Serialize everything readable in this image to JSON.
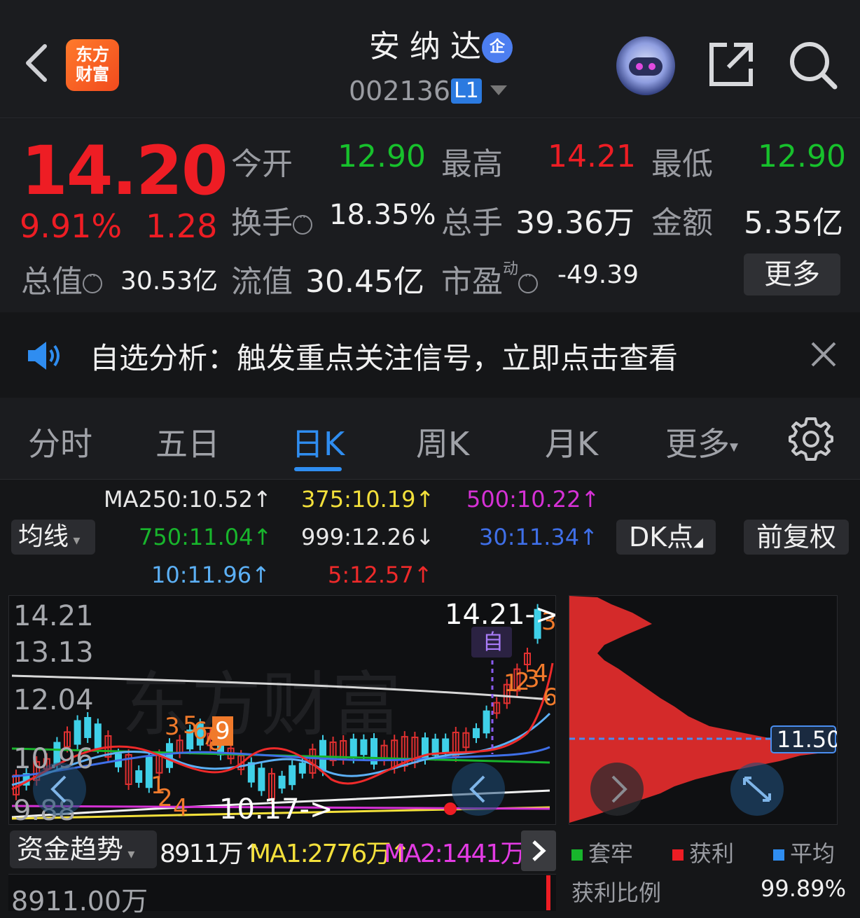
{
  "header": {
    "app_logo_text": [
      "东方",
      "财富"
    ],
    "stock_name": "安纳达",
    "company_badge": "企",
    "stock_code": "002136",
    "level_badge": "L1"
  },
  "quote": {
    "price": "14.20",
    "change_pct": "9.91%",
    "change": "1.28",
    "open_label": "今开",
    "open": "12.90",
    "high_label": "最高",
    "high": "14.21",
    "low_label": "最低",
    "low": "12.90",
    "turnover_label": "换手",
    "turnover": "18.35%",
    "volume_label": "总手",
    "volume": "39.36万",
    "amount_label": "金额",
    "amount": "5.35亿",
    "mktcap_label": "总值",
    "mktcap": "30.53亿",
    "float_label": "流值",
    "float_cap": "30.45亿",
    "pe_label": "市盈",
    "pe_sup": "动",
    "pe": "-49.39",
    "more_label": "更多"
  },
  "notice": {
    "text": "自选分析：触发重点关注信号，立即点击查看"
  },
  "tabs": [
    {
      "label": "分时"
    },
    {
      "label": "五日"
    },
    {
      "label": "日K",
      "active": true
    },
    {
      "label": "周K"
    },
    {
      "label": "月K"
    },
    {
      "label": "更多"
    }
  ],
  "ma_legend": {
    "ma250": "MA250:10.52↑",
    "ma375": "375:10.19↑",
    "ma500": "500:10.22↑",
    "ma750": "750:11.04↑",
    "ma999": "999:12.26↓",
    "ma30": "30:11.34↑",
    "ma10": "10:11.96↑",
    "ma5": "5:12.57↑",
    "ma_selector": "均线",
    "dk_button": "DK点",
    "adjust_button": "前复权",
    "colors": {
      "ma250": "#e8e8e8",
      "ma375": "#f3e03b",
      "ma500": "#d531d5",
      "ma750": "#18b52c",
      "ma999": "#e8e8e8",
      "ma30": "#3f6fe8",
      "ma10": "#5cb0f5",
      "ma5": "#ee2a2a"
    }
  },
  "chart": {
    "y_ticks": [
      "14.21",
      "13.13",
      "12.04",
      "10.96",
      "9.88"
    ],
    "high_marker": "14.21->",
    "low_marker": "10.17->",
    "self_badge": "自",
    "signals": [
      "3",
      "5",
      "6",
      "7",
      "8",
      "9",
      "1",
      "2",
      "4",
      "1",
      "2",
      "3",
      "4",
      "6"
    ],
    "watermark": "东方财富"
  },
  "chip": {
    "avg_price": "11.50"
  },
  "indicator": {
    "name": "资金趋势",
    "value": "8911万↑",
    "ma1": "MA1:2776万↑",
    "ma2": "MA2:1441万↑",
    "level": "8911.00万"
  },
  "chip_legend": {
    "trapped": "套牢",
    "profit": "获利",
    "average": "平均",
    "profit_ratio_label": "获利比例",
    "profit_ratio": "99.89%"
  }
}
